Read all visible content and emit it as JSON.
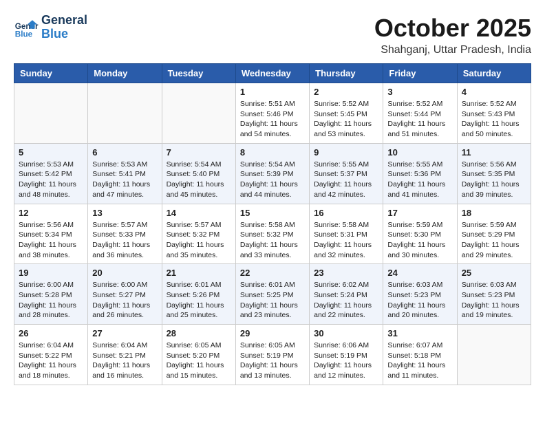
{
  "logo": {
    "line1": "General",
    "line2": "Blue"
  },
  "title": "October 2025",
  "subtitle": "Shahganj, Uttar Pradesh, India",
  "weekdays": [
    "Sunday",
    "Monday",
    "Tuesday",
    "Wednesday",
    "Thursday",
    "Friday",
    "Saturday"
  ],
  "weeks": [
    [
      {
        "day": "",
        "info": ""
      },
      {
        "day": "",
        "info": ""
      },
      {
        "day": "",
        "info": ""
      },
      {
        "day": "1",
        "info": "Sunrise: 5:51 AM\nSunset: 5:46 PM\nDaylight: 11 hours\nand 54 minutes."
      },
      {
        "day": "2",
        "info": "Sunrise: 5:52 AM\nSunset: 5:45 PM\nDaylight: 11 hours\nand 53 minutes."
      },
      {
        "day": "3",
        "info": "Sunrise: 5:52 AM\nSunset: 5:44 PM\nDaylight: 11 hours\nand 51 minutes."
      },
      {
        "day": "4",
        "info": "Sunrise: 5:52 AM\nSunset: 5:43 PM\nDaylight: 11 hours\nand 50 minutes."
      }
    ],
    [
      {
        "day": "5",
        "info": "Sunrise: 5:53 AM\nSunset: 5:42 PM\nDaylight: 11 hours\nand 48 minutes."
      },
      {
        "day": "6",
        "info": "Sunrise: 5:53 AM\nSunset: 5:41 PM\nDaylight: 11 hours\nand 47 minutes."
      },
      {
        "day": "7",
        "info": "Sunrise: 5:54 AM\nSunset: 5:40 PM\nDaylight: 11 hours\nand 45 minutes."
      },
      {
        "day": "8",
        "info": "Sunrise: 5:54 AM\nSunset: 5:39 PM\nDaylight: 11 hours\nand 44 minutes."
      },
      {
        "day": "9",
        "info": "Sunrise: 5:55 AM\nSunset: 5:37 PM\nDaylight: 11 hours\nand 42 minutes."
      },
      {
        "day": "10",
        "info": "Sunrise: 5:55 AM\nSunset: 5:36 PM\nDaylight: 11 hours\nand 41 minutes."
      },
      {
        "day": "11",
        "info": "Sunrise: 5:56 AM\nSunset: 5:35 PM\nDaylight: 11 hours\nand 39 minutes."
      }
    ],
    [
      {
        "day": "12",
        "info": "Sunrise: 5:56 AM\nSunset: 5:34 PM\nDaylight: 11 hours\nand 38 minutes."
      },
      {
        "day": "13",
        "info": "Sunrise: 5:57 AM\nSunset: 5:33 PM\nDaylight: 11 hours\nand 36 minutes."
      },
      {
        "day": "14",
        "info": "Sunrise: 5:57 AM\nSunset: 5:32 PM\nDaylight: 11 hours\nand 35 minutes."
      },
      {
        "day": "15",
        "info": "Sunrise: 5:58 AM\nSunset: 5:32 PM\nDaylight: 11 hours\nand 33 minutes."
      },
      {
        "day": "16",
        "info": "Sunrise: 5:58 AM\nSunset: 5:31 PM\nDaylight: 11 hours\nand 32 minutes."
      },
      {
        "day": "17",
        "info": "Sunrise: 5:59 AM\nSunset: 5:30 PM\nDaylight: 11 hours\nand 30 minutes."
      },
      {
        "day": "18",
        "info": "Sunrise: 5:59 AM\nSunset: 5:29 PM\nDaylight: 11 hours\nand 29 minutes."
      }
    ],
    [
      {
        "day": "19",
        "info": "Sunrise: 6:00 AM\nSunset: 5:28 PM\nDaylight: 11 hours\nand 28 minutes."
      },
      {
        "day": "20",
        "info": "Sunrise: 6:00 AM\nSunset: 5:27 PM\nDaylight: 11 hours\nand 26 minutes."
      },
      {
        "day": "21",
        "info": "Sunrise: 6:01 AM\nSunset: 5:26 PM\nDaylight: 11 hours\nand 25 minutes."
      },
      {
        "day": "22",
        "info": "Sunrise: 6:01 AM\nSunset: 5:25 PM\nDaylight: 11 hours\nand 23 minutes."
      },
      {
        "day": "23",
        "info": "Sunrise: 6:02 AM\nSunset: 5:24 PM\nDaylight: 11 hours\nand 22 minutes."
      },
      {
        "day": "24",
        "info": "Sunrise: 6:03 AM\nSunset: 5:23 PM\nDaylight: 11 hours\nand 20 minutes."
      },
      {
        "day": "25",
        "info": "Sunrise: 6:03 AM\nSunset: 5:23 PM\nDaylight: 11 hours\nand 19 minutes."
      }
    ],
    [
      {
        "day": "26",
        "info": "Sunrise: 6:04 AM\nSunset: 5:22 PM\nDaylight: 11 hours\nand 18 minutes."
      },
      {
        "day": "27",
        "info": "Sunrise: 6:04 AM\nSunset: 5:21 PM\nDaylight: 11 hours\nand 16 minutes."
      },
      {
        "day": "28",
        "info": "Sunrise: 6:05 AM\nSunset: 5:20 PM\nDaylight: 11 hours\nand 15 minutes."
      },
      {
        "day": "29",
        "info": "Sunrise: 6:05 AM\nSunset: 5:19 PM\nDaylight: 11 hours\nand 13 minutes."
      },
      {
        "day": "30",
        "info": "Sunrise: 6:06 AM\nSunset: 5:19 PM\nDaylight: 11 hours\nand 12 minutes."
      },
      {
        "day": "31",
        "info": "Sunrise: 6:07 AM\nSunset: 5:18 PM\nDaylight: 11 hours\nand 11 minutes."
      },
      {
        "day": "",
        "info": ""
      }
    ]
  ]
}
